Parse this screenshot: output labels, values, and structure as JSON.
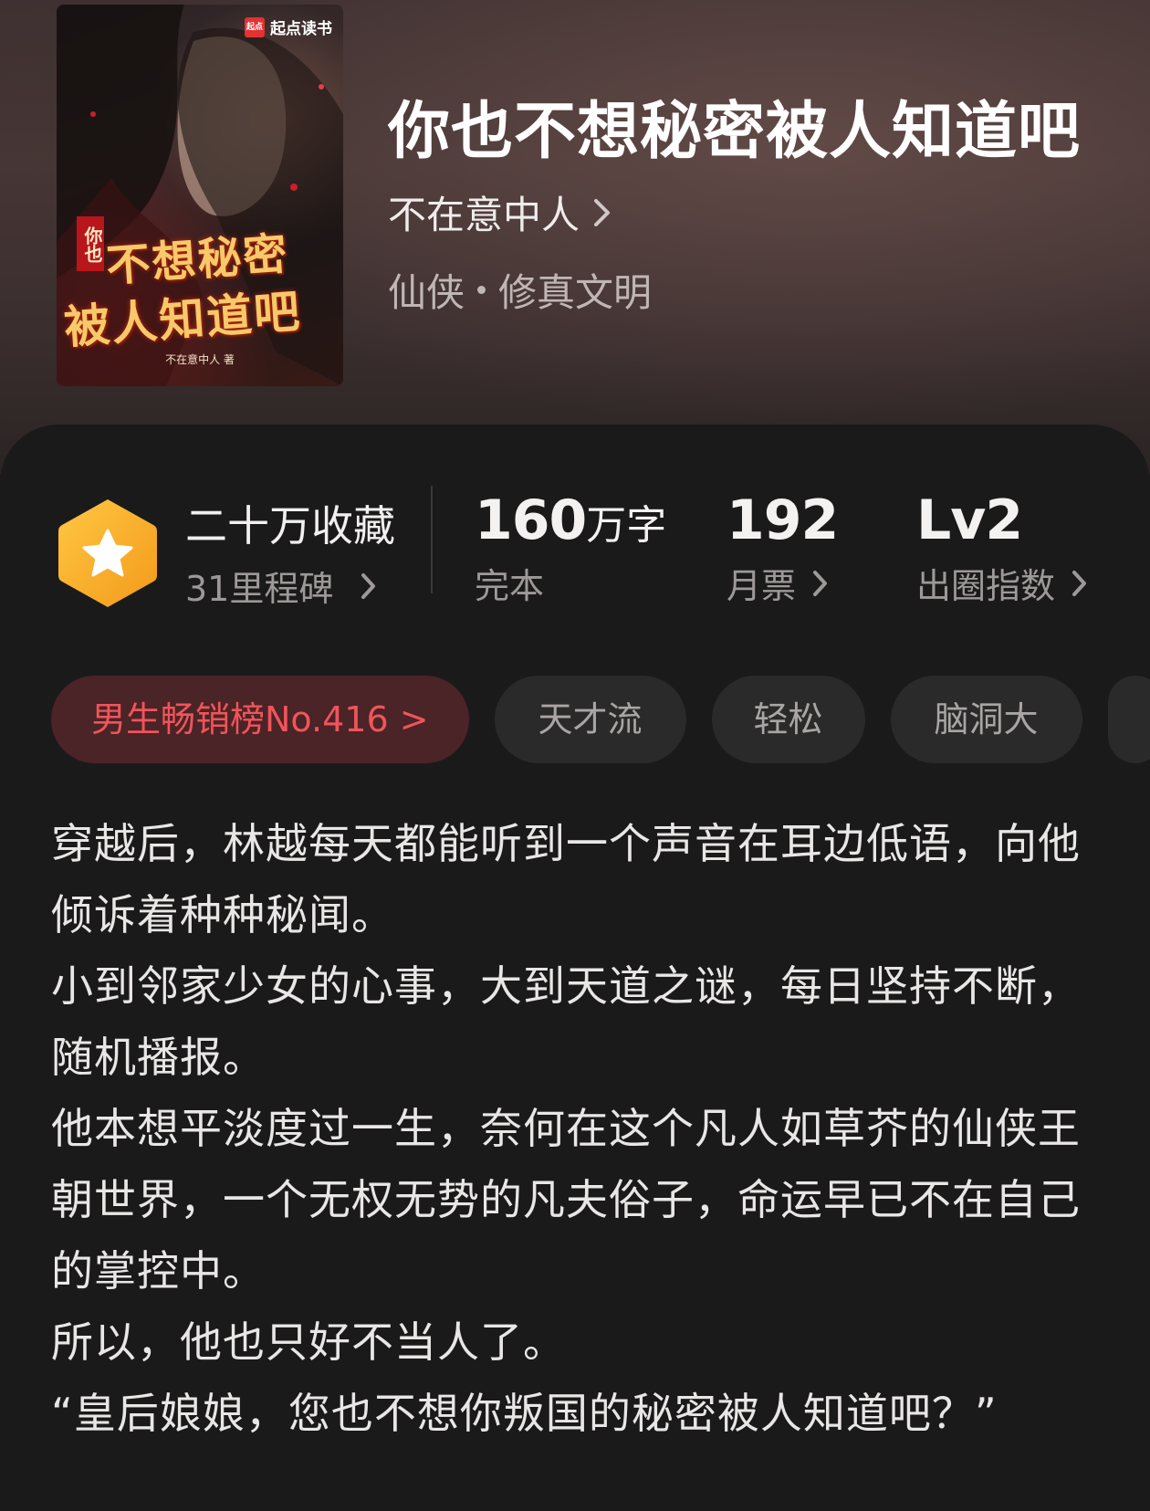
{
  "book": {
    "title": "你也不想秘密被人知道吧",
    "author": "不在意中人",
    "genre": "仙侠",
    "subgenre": "修真文明"
  },
  "cover": {
    "publisher": "起点读书",
    "publisher_logo": "起点",
    "title_small": "你也",
    "title_line1": "不想秘密",
    "title_line2": "被人知道吧",
    "author_line": "不在意中人 著"
  },
  "stats": {
    "collect_title": "二十万收藏",
    "collect_sub": "31里程碑",
    "words_num": "160",
    "words_unit": "万字",
    "words_label": "完本",
    "tickets_num": "192",
    "tickets_label": "月票",
    "level_num": "Lv2",
    "level_label": "出圈指数"
  },
  "tags": {
    "rank": "男生畅销榜No.416 >",
    "t1": "天才流",
    "t2": "轻松",
    "t3": "脑洞大"
  },
  "synopsis": {
    "p1": "穿越后，林越每天都能听到一个声音在耳边低语，向他倾诉着种种秘闻。",
    "p2": "小到邻家少女的心事，大到天道之谜，每日坚持不断，随机播报。",
    "p3": "他本想平淡度过一生，奈何在这个凡人如草芥的仙侠王朝世界，一个无权无势的凡夫俗子，命运早已不在自己的掌控中。",
    "p4": "所以，他也只好不当人了。",
    "p5": "“皇后娘娘，您也不想你叛国的秘密被人知道吧？”"
  },
  "colors": {
    "accent_red": "#f0545a",
    "badge_yellow": "#f7b52b"
  },
  "icons": {
    "chevron": "chevron-right-icon",
    "star_badge": "star-hexagon-icon"
  }
}
